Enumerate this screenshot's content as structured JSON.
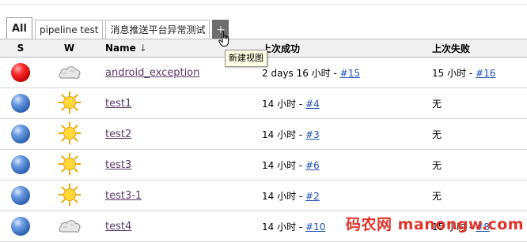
{
  "tabs": [
    {
      "label": "All",
      "active": true
    },
    {
      "label": "pipeline test",
      "active": false
    },
    {
      "label": "消息推送平台异常测试",
      "active": false
    }
  ],
  "add_tab": {
    "label": "+",
    "tooltip": "新建视图"
  },
  "table": {
    "headers": {
      "s": "S",
      "w": "W",
      "name": "Name",
      "sort_indicator": "↓",
      "last_success": "上次成功",
      "last_failure": "上次失败"
    },
    "rows": [
      {
        "status": "red",
        "weather": "cloud",
        "name": "android_exception",
        "succ_time": "2 days 16 小时 - ",
        "succ_build": "#15",
        "fail_time": "15 小时 - ",
        "fail_build": "#16"
      },
      {
        "status": "blue",
        "weather": "sun",
        "name": "test1",
        "succ_time": "14 小时 - ",
        "succ_build": "#4",
        "fail_time": "无",
        "fail_build": ""
      },
      {
        "status": "blue",
        "weather": "sun",
        "name": "test2",
        "succ_time": "14 小时 - ",
        "succ_build": "#3",
        "fail_time": "无",
        "fail_build": ""
      },
      {
        "status": "blue",
        "weather": "sun",
        "name": "test3",
        "succ_time": "14 小时 - ",
        "succ_build": "#6",
        "fail_time": "无",
        "fail_build": ""
      },
      {
        "status": "blue",
        "weather": "sun",
        "name": "test3-1",
        "succ_time": "14 小时 - ",
        "succ_build": "#2",
        "fail_time": "无",
        "fail_build": ""
      },
      {
        "status": "blue",
        "weather": "cloud",
        "name": "test4",
        "succ_time": "14 小时 - ",
        "succ_build": "#10",
        "fail_time": "15 小时 - ",
        "fail_build": "#8"
      }
    ]
  },
  "watermark": "码农网 manongw.com"
}
